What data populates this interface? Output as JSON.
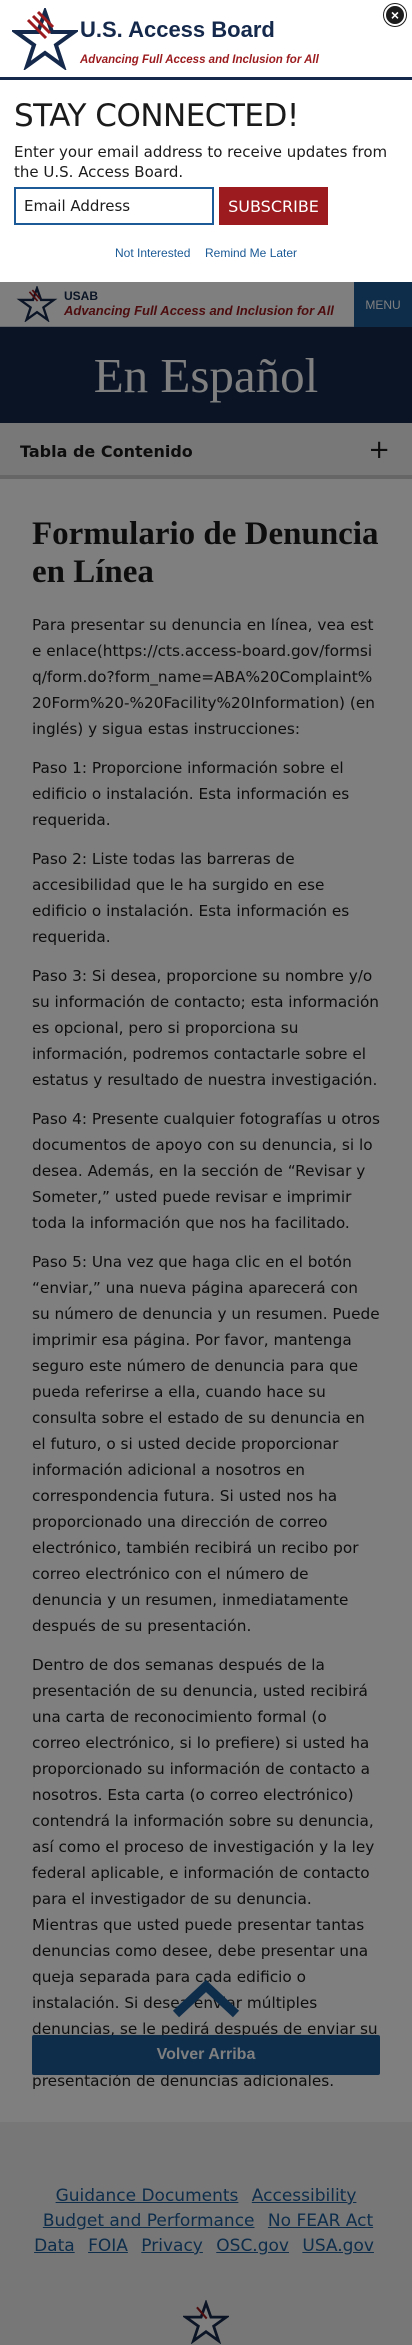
{
  "modal": {
    "brand_name": "U.S. Access Board",
    "brand_tagline": "Advancing Full Access and Inclusion for All",
    "close_label": "×",
    "heading": "STAY CONNECTED!",
    "prompt": "Enter your email address to receive updates from the U.S. Access Board.",
    "email_placeholder": "Email Address",
    "subscribe_label": "SUBSCRIBE",
    "not_interested_label": "Not Interested",
    "remind_label": "Remind Me Later"
  },
  "header": {
    "short_name": "USAB",
    "tagline": "Advancing Full Access and Inclusion for All",
    "menu_label": "MENU"
  },
  "hero": {
    "title": "En Español"
  },
  "toc": {
    "label": "Tabla de Contenido",
    "toggle": "+"
  },
  "main": {
    "title": "Formulario de Denuncia en Línea",
    "paragraphs": [
      "Para presentar su denuncia en línea, vea este enlace(https://cts.access-board.gov/formsiq/form.do?form_name=ABA%20Complaint%20Form%20-%20Facility%20Information) (en inglés) y sigua estas instrucciones:",
      "Paso 1: Proporcione información sobre el edificio o instalación. Esta información es requerida.",
      "Paso 2: Liste todas las barreras de accesibilidad que le ha surgido en ese edificio o instalación. Esta información es requerida.",
      "Paso 3: Si desea, proporcione su nombre y/o su información de contacto; esta información es opcional, pero si proporciona su información, podremos contactarle sobre el estatus y resultado de nuestra investigación.",
      "Paso 4: Presente cualquier fotografías u otros documentos de apoyo con su denuncia, si lo desea. Además, en la sección de “Revisar y Someter,” usted puede revisar e imprimir toda la información que nos ha facilitado.",
      "Paso 5: Una vez que haga clic en el botón “enviar,” una nueva página aparecerá con su número de denuncia y un resumen. Puede imprimir esa página. Por favor, mantenga seguro este número de denuncia para que pueda referirse a ella, cuando hace su consulta sobre el estado de su denuncia en el futuro, o si usted decide proporcionar información adicional a nosotros en correspondencia futura. Si usted nos ha proporcionado una dirección de correo electrónico, también recibirá un recibo por correo electrónico con el número de denuncia y un resumen, inmediatamente después de su presentación.",
      "Dentro de dos semanas después de la presentación de su denuncia, usted recibirá una carta de reconocimiento formal (o correo electrónico, si lo prefiere) si usted ha proporcionado su información de contacto a nosotros. Esta carta (o correo electrónico) contendrá la información sobre su denuncia, así como el proceso de investigación y la ley federal aplicable, e información de contacto para el investigador de su denuncia. Mientras que usted puede presentar tantas denuncias como desee, debe presentar una queja separada para cada edificio o instalación. Si desea enviar múltiples denuncias, se le pedirá después de enviar su primera denuncia con instrucciones para la presentación de denuncias adicionales."
    ],
    "back_to_top_label": "Volver Arriba"
  },
  "footer": {
    "links": [
      "Guidance Documents",
      "Accessibility",
      "Budget and Performance",
      "No FEAR Act Data",
      "FOIA",
      "Privacy",
      "OSC.gov",
      "USA.gov"
    ]
  },
  "colors": {
    "navy": "#14294b",
    "brand_red": "#9b1b1e",
    "link_blue": "#1b5a96"
  }
}
